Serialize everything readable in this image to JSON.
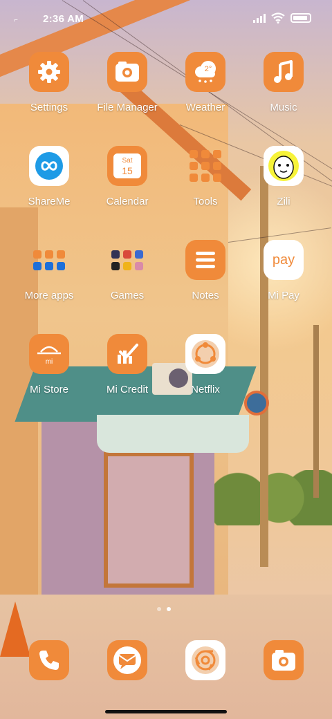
{
  "status_bar": {
    "time": "2:36 AM"
  },
  "apps": [
    {
      "name": "settings",
      "label": "Settings",
      "style": "orange",
      "icon": "gear-icon"
    },
    {
      "name": "file-manager",
      "label": "File Manager",
      "style": "orange",
      "icon": "folder-camera-icon"
    },
    {
      "name": "weather",
      "label": "Weather",
      "style": "orange",
      "icon": "cloud-icon",
      "icon_text": "2°"
    },
    {
      "name": "music",
      "label": "Music",
      "style": "orange",
      "icon": "music-note-icon"
    },
    {
      "name": "shareme",
      "label": "ShareMe",
      "style": "light",
      "icon": "infinity-icon"
    },
    {
      "name": "calendar",
      "label": "Calendar",
      "style": "orange",
      "icon": "calendar-icon",
      "icon_text": "Sat",
      "icon_num": "15"
    },
    {
      "name": "tools",
      "label": "Tools",
      "style": "folder",
      "icon": "folder-icon"
    },
    {
      "name": "zili",
      "label": "Zili",
      "style": "light",
      "icon": "zili-face-icon"
    },
    {
      "name": "more-apps",
      "label": "More apps",
      "style": "folder",
      "icon": "folder-icon"
    },
    {
      "name": "games",
      "label": "Games",
      "style": "folder",
      "icon": "folder-icon"
    },
    {
      "name": "notes",
      "label": "Notes",
      "style": "orange",
      "icon": "hamburger-icon"
    },
    {
      "name": "mi-pay",
      "label": "Mi Pay",
      "style": "light",
      "icon": "pay-icon",
      "icon_text": "pay"
    },
    {
      "name": "mi-store",
      "label": "Mi Store",
      "style": "orange",
      "icon": "store-bag-icon",
      "icon_text": "mi"
    },
    {
      "name": "mi-credit",
      "label": "Mi Credit",
      "style": "orange",
      "icon": "chart-check-icon"
    },
    {
      "name": "netflix",
      "label": "Netflix",
      "style": "light",
      "icon": "share-nodes-icon"
    }
  ],
  "dock": [
    {
      "name": "phone",
      "icon": "phone-icon"
    },
    {
      "name": "messaging",
      "icon": "message-icon"
    },
    {
      "name": "browser",
      "icon": "chrome-icon"
    },
    {
      "name": "camera",
      "icon": "camera-icon"
    }
  ],
  "colors": {
    "accent": "#f08a3a",
    "label": "#ffffff"
  }
}
